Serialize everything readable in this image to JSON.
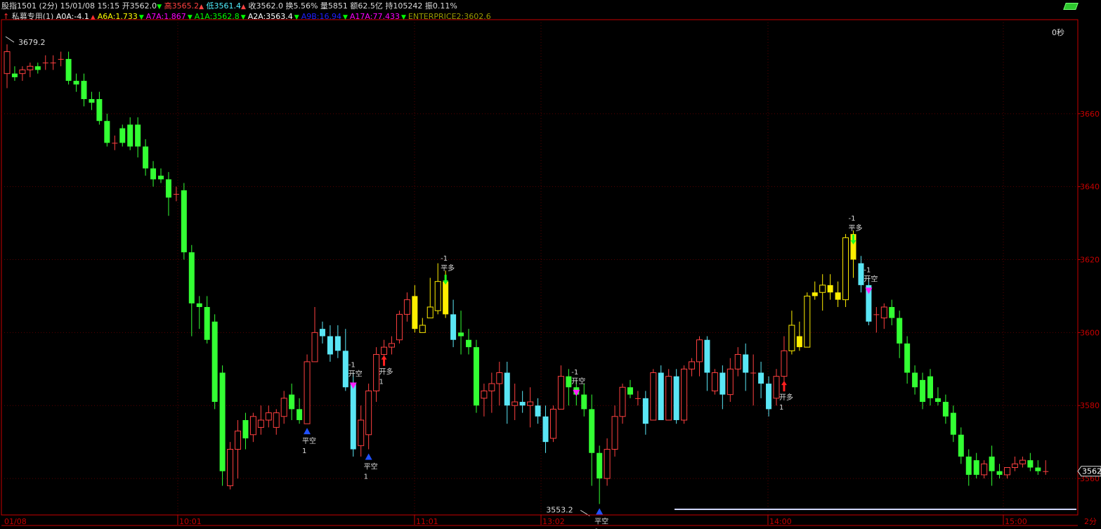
{
  "header": {
    "name": "股指1501 (2分)",
    "datetime": "15/01/08 15:15",
    "open_label": "开3562.0",
    "high_label": "高3565.2",
    "low_label": "低3561.4",
    "close_label": "收3562.0",
    "turnover_label": "换5.56%",
    "volume_label": "量5851",
    "amount_label": "额62.5亿",
    "hold_label": "持105242",
    "swing_label": "振0.11%"
  },
  "indicator": {
    "name": "私募专用(1)",
    "values": [
      {
        "text": "A0A:-4.1",
        "color": "#ffffff",
        "arrow": "▲",
        "arrow_color": "#ff3030"
      },
      {
        "text": "A6A:1.733",
        "color": "#ffff00",
        "arrow": "▼",
        "arrow_color": "#00ff00"
      },
      {
        "text": "A7A:1.867",
        "color": "#ff00ff",
        "arrow": "▼",
        "arrow_color": "#00ff00"
      },
      {
        "text": "A1A:3562.8",
        "color": "#00ff00",
        "arrow": "▼",
        "arrow_color": "#00ff00"
      },
      {
        "text": "A2A:3563.4",
        "color": "#ffffff",
        "arrow": "▼",
        "arrow_color": "#00ff00"
      },
      {
        "text": "A9B:16.94",
        "color": "#2020ff",
        "arrow": "▼",
        "arrow_color": "#00ff00"
      },
      {
        "text": "A17A:77.433",
        "color": "#ff00ff",
        "arrow": "▼",
        "arrow_color": "#00ff00"
      },
      {
        "text": "ENTERPRICE2:3602.6",
        "color": "#9a9a00",
        "arrow": "",
        "arrow_color": ""
      }
    ]
  },
  "seconds_label": "0秒",
  "colors": {
    "up": "#ff4040",
    "down_green": "#33ff33",
    "down_cyan": "#5ae6f5",
    "yellow": "#ffee00",
    "axis": "#c80000",
    "grid": "#5a0000",
    "text": "#dddddd"
  },
  "chart_data": {
    "type": "candlestick",
    "ylim": [
      3550,
      3685
    ],
    "yticks": [
      "3560",
      "3580",
      "3600",
      "3620",
      "3640",
      "3660"
    ],
    "xticks": [
      "01/08",
      "10:01",
      "11:01",
      "13:02",
      "14:00",
      "15:00",
      "2分"
    ],
    "last_price_label": "3562",
    "high_marker": {
      "label": "3679.2",
      "value": 3679.2
    },
    "low_marker": {
      "label": "3553.2",
      "value": 3553.2
    },
    "candles": [
      {
        "o": 3671,
        "h": 3679,
        "c": 3677,
        "l": 3667
      },
      {
        "o": 3671,
        "h": 3673,
        "c": 3670,
        "l": 3669
      },
      {
        "o": 3671,
        "h": 3673,
        "c": 3672,
        "l": 3669
      },
      {
        "o": 3672,
        "h": 3674,
        "c": 3673,
        "l": 3670
      },
      {
        "o": 3673,
        "h": 3674,
        "c": 3672,
        "l": 3671
      },
      {
        "o": 3674,
        "h": 3676,
        "c": 3674,
        "l": 3672
      },
      {
        "o": 3674,
        "h": 3676,
        "c": 3674,
        "l": 3672
      },
      {
        "o": 3675,
        "h": 3677,
        "c": 3675,
        "l": 3673
      },
      {
        "o": 3675,
        "h": 3677,
        "c": 3669,
        "l": 3668
      },
      {
        "o": 3669,
        "h": 3671,
        "c": 3668,
        "l": 3666
      },
      {
        "o": 3669,
        "h": 3671,
        "c": 3664,
        "l": 3662
      },
      {
        "o": 3664,
        "h": 3666,
        "c": 3663,
        "l": 3661
      },
      {
        "o": 3664,
        "h": 3666,
        "c": 3658,
        "l": 3657
      },
      {
        "o": 3658,
        "h": 3660,
        "c": 3652,
        "l": 3651
      },
      {
        "o": 3652,
        "h": 3654,
        "c": 3652,
        "l": 3650
      },
      {
        "o": 3656,
        "h": 3657,
        "c": 3652,
        "l": 3651
      },
      {
        "o": 3657,
        "h": 3659,
        "c": 3651,
        "l": 3650
      },
      {
        "o": 3657,
        "h": 3659,
        "c": 3651,
        "l": 3648
      },
      {
        "o": 3651,
        "h": 3653,
        "c": 3645,
        "l": 3643
      },
      {
        "o": 3645,
        "h": 3647,
        "c": 3642,
        "l": 3640
      },
      {
        "o": 3643,
        "h": 3645,
        "c": 3642,
        "l": 3641
      },
      {
        "o": 3642,
        "h": 3644,
        "c": 3637,
        "l": 3632
      },
      {
        "o": 3638,
        "h": 3640,
        "c": 3638,
        "l": 3636
      },
      {
        "o": 3639,
        "h": 3641,
        "c": 3622,
        "l": 3620
      },
      {
        "o": 3622,
        "h": 3624,
        "c": 3608,
        "l": 3599
      },
      {
        "o": 3608,
        "h": 3610,
        "c": 3607,
        "l": 3601
      },
      {
        "o": 3607,
        "h": 3610,
        "c": 3598,
        "l": 3597
      },
      {
        "o": 3603,
        "h": 3605,
        "c": 3581,
        "l": 3579
      },
      {
        "o": 3589,
        "h": 3591,
        "c": 3562,
        "l": 3558
      },
      {
        "o": 3558,
        "h": 3570,
        "c": 3568,
        "l": 3557
      },
      {
        "o": 3568,
        "h": 3576,
        "c": 3573,
        "l": 3560
      },
      {
        "o": 3576,
        "h": 3578,
        "c": 3571,
        "l": 3568
      },
      {
        "o": 3572,
        "h": 3578,
        "c": 3577,
        "l": 3570
      },
      {
        "o": 3574,
        "h": 3580,
        "c": 3576,
        "l": 3572
      },
      {
        "o": 3576,
        "h": 3580,
        "c": 3578,
        "l": 3574
      },
      {
        "o": 3574,
        "h": 3579,
        "c": 3578,
        "l": 3572
      },
      {
        "o": 3577,
        "h": 3584,
        "c": 3582,
        "l": 3575
      },
      {
        "o": 3583,
        "h": 3586,
        "c": 3579,
        "l": 3576
      },
      {
        "o": 3579,
        "h": 3582,
        "c": 3576,
        "l": 3575
      },
      {
        "o": 3575,
        "h": 3594,
        "c": 3592,
        "l": 3575
      },
      {
        "o": 3592,
        "h": 3607,
        "c": 3600,
        "l": 3592
      },
      {
        "o": 3601,
        "h": 3603,
        "c": 3599,
        "l": 3597
      },
      {
        "o": 3599,
        "h": 3602,
        "c": 3594,
        "l": 3592
      },
      {
        "o": 3599,
        "h": 3602,
        "c": 3595,
        "l": 3593
      },
      {
        "o": 3595,
        "h": 3601,
        "c": 3585,
        "l": 3584
      },
      {
        "o": 3586,
        "h": 3589,
        "c": 3568,
        "l": 3566
      },
      {
        "o": 3569,
        "h": 3580,
        "c": 3576,
        "l": 3566
      },
      {
        "o": 3572,
        "h": 3586,
        "c": 3584,
        "l": 3568
      },
      {
        "o": 3584,
        "h": 3596,
        "c": 3594,
        "l": 3581
      },
      {
        "o": 3594,
        "h": 3598,
        "c": 3596,
        "l": 3593
      },
      {
        "o": 3596,
        "h": 3599,
        "c": 3597,
        "l": 3594
      },
      {
        "o": 3598,
        "h": 3606,
        "c": 3605,
        "l": 3597
      },
      {
        "o": 3605,
        "h": 3611,
        "c": 3609,
        "l": 3603
      },
      {
        "o": 3610,
        "h": 3613,
        "c": 3601,
        "l": 3600
      },
      {
        "o": 3600,
        "h": 3604,
        "c": 3602,
        "l": 3600
      },
      {
        "o": 3604,
        "h": 3615,
        "c": 3607,
        "l": 3604
      },
      {
        "o": 3606,
        "h": 3619,
        "c": 3614,
        "l": 3605
      },
      {
        "o": 3614,
        "h": 3617,
        "c": 3605,
        "l": 3604
      },
      {
        "o": 3605,
        "h": 3609,
        "c": 3598,
        "l": 3596
      },
      {
        "o": 3600,
        "h": 3606,
        "c": 3599,
        "l": 3594
      },
      {
        "o": 3598,
        "h": 3601,
        "c": 3596,
        "l": 3594
      },
      {
        "o": 3596,
        "h": 3598,
        "c": 3580,
        "l": 3578
      },
      {
        "o": 3582,
        "h": 3586,
        "c": 3584,
        "l": 3577
      },
      {
        "o": 3584,
        "h": 3589,
        "c": 3586,
        "l": 3578
      },
      {
        "o": 3586,
        "h": 3592,
        "c": 3589,
        "l": 3580
      },
      {
        "o": 3589,
        "h": 3592,
        "c": 3580,
        "l": 3575
      },
      {
        "o": 3580,
        "h": 3586,
        "c": 3581,
        "l": 3576
      },
      {
        "o": 3581,
        "h": 3584,
        "c": 3580,
        "l": 3578
      },
      {
        "o": 3580,
        "h": 3585,
        "c": 3581,
        "l": 3574
      },
      {
        "o": 3580,
        "h": 3582,
        "c": 3577,
        "l": 3575
      },
      {
        "o": 3577,
        "h": 3580,
        "c": 3570,
        "l": 3567
      },
      {
        "o": 3571,
        "h": 3580,
        "c": 3579,
        "l": 3570
      },
      {
        "o": 3579,
        "h": 3591,
        "c": 3588,
        "l": 3579
      },
      {
        "o": 3588,
        "h": 3590,
        "c": 3585,
        "l": 3580
      },
      {
        "o": 3585,
        "h": 3587,
        "c": 3583,
        "l": 3580
      },
      {
        "o": 3583,
        "h": 3586,
        "c": 3579,
        "l": 3577
      },
      {
        "o": 3579,
        "h": 3583,
        "c": 3567,
        "l": 3558
      },
      {
        "o": 3567,
        "h": 3569,
        "c": 3560,
        "l": 3553
      },
      {
        "o": 3560,
        "h": 3571,
        "c": 3568,
        "l": 3558
      },
      {
        "o": 3568,
        "h": 3580,
        "c": 3577,
        "l": 3566
      },
      {
        "o": 3577,
        "h": 3586,
        "c": 3585,
        "l": 3575
      },
      {
        "o": 3585,
        "h": 3587,
        "c": 3583,
        "l": 3582
      },
      {
        "o": 3582,
        "h": 3584,
        "c": 3582,
        "l": 3580
      },
      {
        "o": 3582,
        "h": 3584,
        "c": 3575,
        "l": 3572
      },
      {
        "o": 3576,
        "h": 3590,
        "c": 3589,
        "l": 3576
      },
      {
        "o": 3589,
        "h": 3591,
        "c": 3576,
        "l": 3576
      },
      {
        "o": 3576,
        "h": 3590,
        "c": 3588,
        "l": 3576
      },
      {
        "o": 3588,
        "h": 3590,
        "c": 3576,
        "l": 3575
      },
      {
        "o": 3576,
        "h": 3591,
        "c": 3590,
        "l": 3575
      },
      {
        "o": 3590,
        "h": 3593,
        "c": 3592,
        "l": 3588
      },
      {
        "o": 3592,
        "h": 3599,
        "c": 3598,
        "l": 3588
      },
      {
        "o": 3598,
        "h": 3599,
        "c": 3589,
        "l": 3584
      },
      {
        "o": 3584,
        "h": 3590,
        "c": 3589,
        "l": 3583
      },
      {
        "o": 3589,
        "h": 3591,
        "c": 3583,
        "l": 3579
      },
      {
        "o": 3583,
        "h": 3593,
        "c": 3590,
        "l": 3581
      },
      {
        "o": 3590,
        "h": 3596,
        "c": 3594,
        "l": 3588
      },
      {
        "o": 3594,
        "h": 3597,
        "c": 3589,
        "l": 3584
      },
      {
        "o": 3589,
        "h": 3594,
        "c": 3589,
        "l": 3580
      },
      {
        "o": 3589,
        "h": 3592,
        "c": 3586,
        "l": 3582
      },
      {
        "o": 3586,
        "h": 3588,
        "c": 3579,
        "l": 3577
      },
      {
        "o": 3582,
        "h": 3590,
        "c": 3588,
        "l": 3580
      },
      {
        "o": 3588,
        "h": 3599,
        "c": 3595,
        "l": 3586
      },
      {
        "o": 3595,
        "h": 3606,
        "c": 3602,
        "l": 3594
      },
      {
        "o": 3599,
        "h": 3603,
        "c": 3596,
        "l": 3595
      },
      {
        "o": 3596,
        "h": 3611,
        "c": 3610,
        "l": 3596
      },
      {
        "o": 3611,
        "h": 3614,
        "c": 3610,
        "l": 3609
      },
      {
        "o": 3611,
        "h": 3616,
        "c": 3613,
        "l": 3606
      },
      {
        "o": 3613,
        "h": 3616,
        "c": 3611,
        "l": 3609
      },
      {
        "o": 3611,
        "h": 3614,
        "c": 3609,
        "l": 3607
      },
      {
        "o": 3609,
        "h": 3627,
        "c": 3626,
        "l": 3607
      },
      {
        "o": 3627,
        "h": 3628,
        "c": 3620,
        "l": 3615
      },
      {
        "o": 3619,
        "h": 3621,
        "c": 3613,
        "l": 3611
      },
      {
        "o": 3613,
        "h": 3615,
        "c": 3603,
        "l": 3602
      },
      {
        "o": 3605,
        "h": 3607,
        "c": 3605,
        "l": 3600
      },
      {
        "o": 3604,
        "h": 3608,
        "c": 3607,
        "l": 3601
      },
      {
        "o": 3607,
        "h": 3609,
        "c": 3604,
        "l": 3602
      },
      {
        "o": 3604,
        "h": 3606,
        "c": 3597,
        "l": 3593
      },
      {
        "o": 3597,
        "h": 3599,
        "c": 3589,
        "l": 3586
      },
      {
        "o": 3589,
        "h": 3591,
        "c": 3585,
        "l": 3583
      },
      {
        "o": 3587,
        "h": 3589,
        "c": 3581,
        "l": 3579
      },
      {
        "o": 3588,
        "h": 3590,
        "c": 3582,
        "l": 3580
      },
      {
        "o": 3582,
        "h": 3585,
        "c": 3581,
        "l": 3580
      },
      {
        "o": 3581,
        "h": 3583,
        "c": 3577,
        "l": 3575
      },
      {
        "o": 3578,
        "h": 3580,
        "c": 3572,
        "l": 3570
      },
      {
        "o": 3572,
        "h": 3574,
        "c": 3566,
        "l": 3564
      },
      {
        "o": 3566,
        "h": 3568,
        "c": 3561,
        "l": 3558
      },
      {
        "o": 3565,
        "h": 3567,
        "c": 3561,
        "l": 3560
      },
      {
        "o": 3561,
        "h": 3565,
        "c": 3564,
        "l": 3560
      },
      {
        "o": 3566,
        "h": 3569,
        "c": 3562,
        "l": 3558
      },
      {
        "o": 3562,
        "h": 3564,
        "c": 3561,
        "l": 3560
      },
      {
        "o": 3561,
        "h": 3563,
        "c": 3563,
        "l": 3560
      },
      {
        "o": 3563,
        "h": 3566,
        "c": 3564,
        "l": 3562
      },
      {
        "o": 3564,
        "h": 3566,
        "c": 3565,
        "l": 3563
      },
      {
        "o": 3565,
        "h": 3567,
        "c": 3563,
        "l": 3562
      },
      {
        "o": 3563,
        "h": 3565,
        "c": 3562,
        "l": 3561
      },
      {
        "o": 3562,
        "h": 3565,
        "c": 3562,
        "l": 3561
      }
    ],
    "signals": [
      {
        "index": 39,
        "type": "up-tri",
        "color": "#2050ff",
        "labels": [
          "平空",
          "1"
        ]
      },
      {
        "index": 45,
        "type": "down-tri",
        "color": "#ff20ff",
        "labels": [
          "-1",
          "开空"
        ]
      },
      {
        "index": 47,
        "type": "up-tri",
        "color": "#2050ff",
        "labels": [
          "平空",
          "1"
        ]
      },
      {
        "index": 49,
        "type": "up-arrow",
        "color": "#ff2020",
        "labels": [
          "开多",
          "1"
        ]
      },
      {
        "index": 57,
        "type": "down-arrow",
        "color": "#20ff20",
        "labels": [
          "-1",
          "平多"
        ]
      },
      {
        "index": 74,
        "type": "down-tri",
        "color": "#ff20ff",
        "labels": [
          "-1",
          "开空"
        ]
      },
      {
        "index": 77,
        "type": "up-tri",
        "color": "#2050ff",
        "labels": [
          "平空",
          "1"
        ]
      },
      {
        "index": 101,
        "type": "up-arrow",
        "color": "#ff2020",
        "labels": [
          "开多",
          "1"
        ]
      },
      {
        "index": 110,
        "type": "down-arrow",
        "color": "#20ff20",
        "labels": [
          "-1",
          "平多"
        ]
      },
      {
        "index": 112,
        "type": "down-tri",
        "color": "#ff20ff",
        "labels": [
          "-1",
          "开空"
        ]
      }
    ]
  }
}
